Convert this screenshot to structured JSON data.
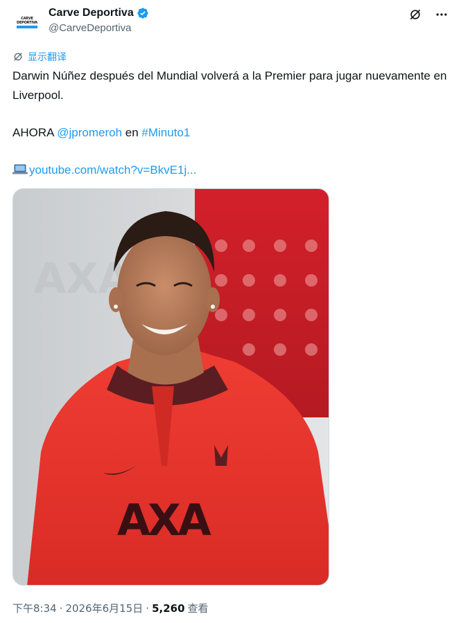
{
  "account": {
    "display_name": "Carve Deportiva",
    "handle": "@CarveDeportiva",
    "verified": true,
    "avatar_logo_text": "CARVE DEPORTIVA"
  },
  "header_icons": [
    "grok-icon",
    "more-icon"
  ],
  "translate": {
    "label": "显示翻译"
  },
  "tweet": {
    "line1": "Darwin Núñez después del Mundial volverá a la Premier para jugar nuevamente en Liverpool.",
    "ahora_prefix": "AHORA ",
    "mention": "@jpromeroh",
    "en_word": " en ",
    "hashtag": "#Minuto1",
    "link_text": "youtube.com/watch?v=BkvE1j..."
  },
  "media": {
    "alt": "Darwin Núñez smiling in red Liverpool training top"
  },
  "meta": {
    "time": "下午8:34",
    "sep1": "·",
    "date": "2026年6月15日",
    "sep2": "·",
    "views_count": "5,260",
    "views_label": "查看"
  },
  "colors": {
    "accent": "#1d9bf0",
    "text": "#0f1419",
    "secondary": "#536471",
    "shirt_red": "#e8322f"
  }
}
